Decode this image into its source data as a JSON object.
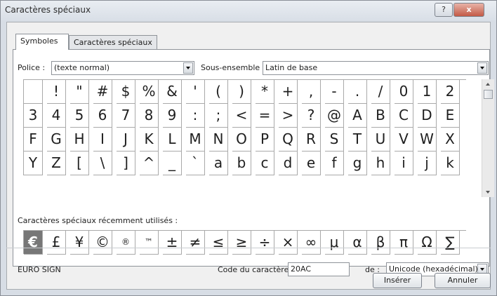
{
  "title": "Caractères spéciaux",
  "titlebar_buttons": {
    "help": "?",
    "close": "x"
  },
  "tabs": [
    {
      "label": "Symboles",
      "active": true
    },
    {
      "label": "Caractères spéciaux",
      "active": false
    }
  ],
  "font": {
    "label": "Police :",
    "value": "(texte normal)"
  },
  "subset": {
    "label": "Sous-ensemble :",
    "value": "Latin de base"
  },
  "symbols": [
    [
      " ",
      "!",
      "\"",
      "#",
      "$",
      "%",
      "&",
      "'",
      "(",
      ")",
      "*",
      "+",
      ",",
      "-",
      ".",
      "/",
      "0",
      "1",
      "2"
    ],
    [
      "3",
      "4",
      "5",
      "6",
      "7",
      "8",
      "9",
      ":",
      ";",
      "<",
      "=",
      ">",
      "?",
      "@",
      "A",
      "B",
      "C",
      "D",
      "E"
    ],
    [
      "F",
      "G",
      "H",
      "I",
      "J",
      "K",
      "L",
      "M",
      "N",
      "O",
      "P",
      "Q",
      "R",
      "S",
      "T",
      "U",
      "V",
      "W",
      "X"
    ],
    [
      "Y",
      "Z",
      "[",
      "\\",
      "]",
      "^",
      "_",
      "`",
      "a",
      "b",
      "c",
      "d",
      "e",
      "f",
      "g",
      "h",
      "i",
      "j",
      "k"
    ]
  ],
  "recent_label": "Caractères spéciaux récemment utilisés :",
  "recent": [
    "€",
    "£",
    "¥",
    "©",
    "®",
    "™",
    "±",
    "≠",
    "≤",
    "≥",
    "÷",
    "×",
    "∞",
    "μ",
    "α",
    "β",
    "π",
    "Ω",
    "∑"
  ],
  "selected_name": "EURO SIGN",
  "char_code": {
    "label": "Code du caractère :",
    "value": "20AC"
  },
  "from": {
    "label": "de :",
    "value": "Unicode (hexadécimal)"
  },
  "buttons": {
    "insert": "Insérer",
    "cancel": "Annuler"
  }
}
